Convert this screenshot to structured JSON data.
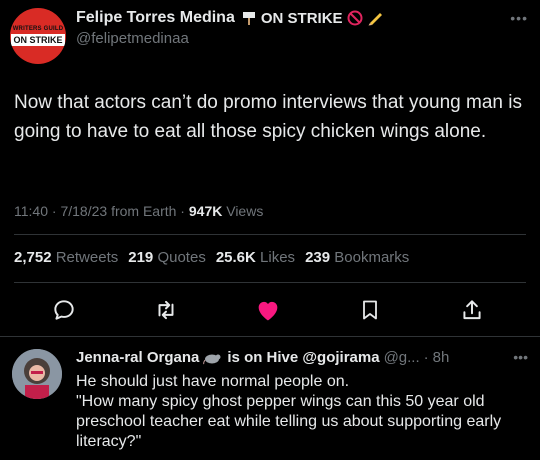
{
  "tweet": {
    "author_name": "Felipe Torres Medina",
    "strike_label": "ON STRIKE",
    "handle": "@felipetmedinaa",
    "avatar_text_top": "WRITERS GUILD",
    "avatar_text_bottom": "ON STRIKE",
    "text": "Now that actors can’t do promo interviews that young man is going to have to eat all those spicy chicken wings alone.",
    "time": "11:40",
    "date": "7/18/23",
    "source": "from Earth",
    "views_count": "947K",
    "views_label": "Views",
    "retweets_count": "2,752",
    "retweets_label": "Retweets",
    "quotes_count": "219",
    "quotes_label": "Quotes",
    "likes_count": "25.6K",
    "likes_label": "Likes",
    "bookmarks_count": "239",
    "bookmarks_label": "Bookmarks"
  },
  "reply": {
    "author_name": "Jenna-ral Organa",
    "name_suffix": "is on Hive @gojirama",
    "handle": "@g...",
    "time": "8h",
    "text_line1": "He should just have normal people on.",
    "text_line2": "\"How many spicy ghost pepper wings can this 50 year old preschool teacher eat while telling us about supporting early literacy?\""
  },
  "colors": {
    "background": "#000000",
    "text": "#e7e9ea",
    "muted": "#71767b",
    "like_pink": "#f91880",
    "avatar_red": "#d92b25"
  },
  "icons": [
    "more-icon",
    "protest-sign-icon",
    "prohibited-icon",
    "pencil-icon",
    "reply-icon",
    "retweet-icon",
    "heart-icon",
    "bookmark-icon",
    "share-icon",
    "rat-icon"
  ]
}
